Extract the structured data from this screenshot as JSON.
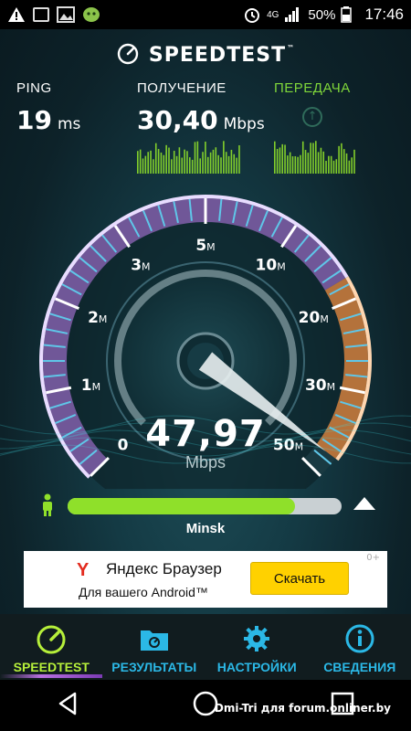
{
  "statusbar": {
    "time": "17:46",
    "battery": "50%",
    "network": "4G",
    "icons": [
      "warning-icon",
      "notification-icon",
      "gallery-icon",
      "app-icon",
      "alarm-icon",
      "signal-icon",
      "battery-icon"
    ]
  },
  "header": {
    "brand": "SPEEDTEST",
    "trademark": "™"
  },
  "metrics": {
    "ping": {
      "label": "PING",
      "value": "19",
      "unit": "ms"
    },
    "download": {
      "label": "ПОЛУЧЕНИЕ",
      "value": "30,40",
      "unit": "Mbps"
    },
    "upload": {
      "label": "ПЕРЕДАЧА"
    }
  },
  "gauge": {
    "ticks": [
      {
        "label": "0",
        "unit": ""
      },
      {
        "label": "1",
        "unit": "M"
      },
      {
        "label": "2",
        "unit": "M"
      },
      {
        "label": "3",
        "unit": "M"
      },
      {
        "label": "5",
        "unit": "M"
      },
      {
        "label": "10",
        "unit": "M"
      },
      {
        "label": "20",
        "unit": "M"
      },
      {
        "label": "30",
        "unit": "M"
      },
      {
        "label": "50",
        "unit": "M"
      }
    ],
    "current_speed": "47,97",
    "unit": "Mbps",
    "needle_fraction": 0.97
  },
  "progress": {
    "fraction": 0.83,
    "server": "Minsk"
  },
  "ad": {
    "logo": "Y",
    "title": "Яндекс Браузер",
    "subtitle": "Для вашего Android™",
    "button": "Скачать",
    "badge": "0+"
  },
  "nav": {
    "items": [
      {
        "label": "SPEEDTEST",
        "icon": "gauge-icon"
      },
      {
        "label": "РЕЗУЛЬТАТЫ",
        "icon": "folder-icon"
      },
      {
        "label": "НАСТРОЙКИ",
        "icon": "gear-icon"
      },
      {
        "label": "СВЕДЕНИЯ",
        "icon": "info-icon"
      }
    ]
  },
  "watermark": "Dmi-Tri для forum.onliner.by",
  "colors": {
    "accent_green": "#8fe02a",
    "accent_blue": "#2bb8e6",
    "gauge_purple": "#b870e0",
    "gauge_orange": "#e8853a"
  }
}
